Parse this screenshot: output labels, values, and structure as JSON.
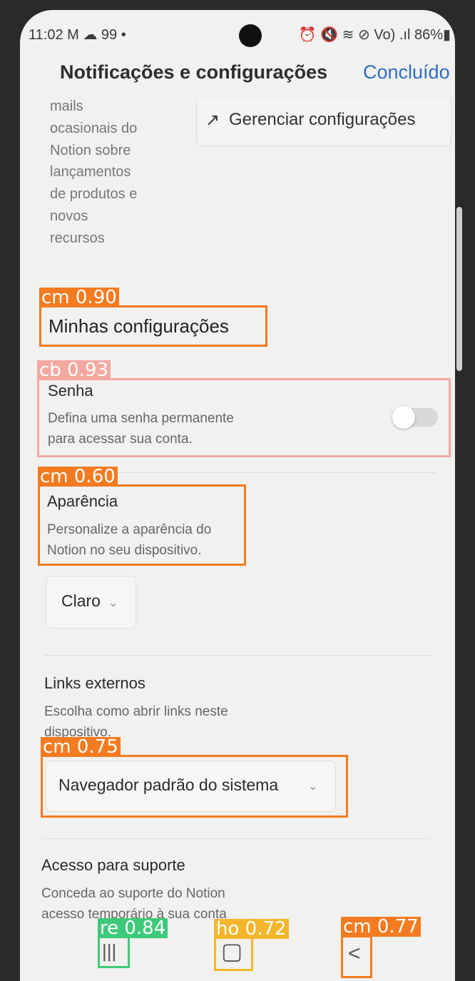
{
  "status_bar": {
    "left": "11:02 M ☁ 99 •",
    "right": "⏰ 🔇 ≋ ⊘ Vo) .ıl 86%▮"
  },
  "header": {
    "title": "Notificações e configurações",
    "done_label": "Concluído"
  },
  "marketing": {
    "text_lines": [
      "mails",
      "ocasionais do",
      "Notion sobre",
      "lançamentos",
      "de produtos e",
      "novos",
      "recursos"
    ],
    "manage_label": "Gerenciar configurações"
  },
  "my_settings": {
    "heading": "Minhas configurações"
  },
  "password": {
    "title": "Senha",
    "desc_line1": "Defina uma senha permanente",
    "desc_line2": "para acessar sua conta.",
    "toggle_on": false
  },
  "appearance": {
    "title": "Aparência",
    "desc_line1": "Personalize a aparência do",
    "desc_line2": "Notion no seu dispositivo.",
    "selected": "Claro"
  },
  "external_links": {
    "title": "Links externos",
    "desc_line1": "Escolha como abrir links neste",
    "desc_line2": "dispositivo.",
    "selected": "Navegador padrão do sistema"
  },
  "support_access": {
    "title": "Acesso para suporte",
    "desc_line1": "Conceda ao suporte do Notion",
    "desc_line2": "acesso temporário à sua conta"
  },
  "detections": [
    {
      "label": "cm 0.90",
      "color": "#f47b20"
    },
    {
      "label": "cb 0.93",
      "color": "#f4a8a0"
    },
    {
      "label": "cm 0.60",
      "color": "#f47b20"
    },
    {
      "label": "cm 0.75",
      "color": "#f47b20"
    },
    {
      "label": "re 0.84",
      "color": "#3ec97a"
    },
    {
      "label": "ho 0.72",
      "color": "#f5b62c"
    },
    {
      "label": "cm 0.77",
      "color": "#f47b20"
    }
  ],
  "nav": {
    "recents_icon": "|||",
    "home_icon": "▢",
    "back_icon": "<"
  }
}
